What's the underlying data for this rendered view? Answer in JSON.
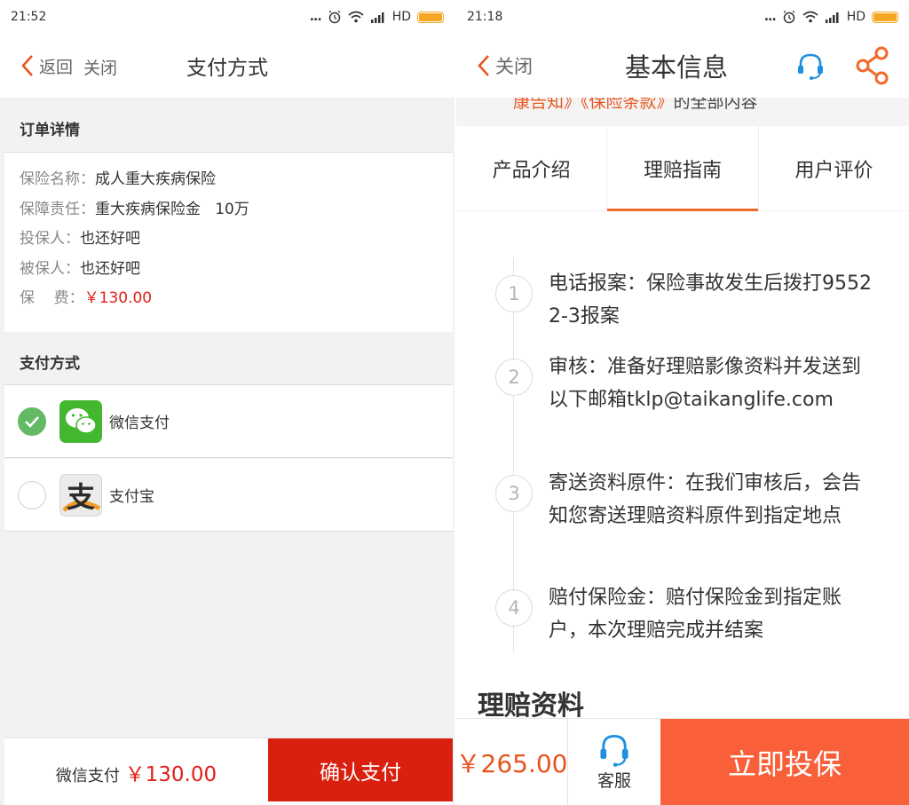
{
  "left": {
    "status": {
      "time": "21:52",
      "dots": "...",
      "network": "HD"
    },
    "nav": {
      "back_label": "返回",
      "close_label": "关闭",
      "title": "支付方式"
    },
    "order": {
      "heading": "订单详情",
      "rows": [
        {
          "key": "保险名称：",
          "value": "成人重大疾病保险"
        },
        {
          "key": "保障责任：",
          "value": "重大疾病保险金   10万"
        },
        {
          "key": "投保人：",
          "value": "也还好吧"
        },
        {
          "key": "被保人：",
          "value": "也还好吧"
        },
        {
          "key": "保    费：",
          "value": "￥130.00"
        }
      ]
    },
    "payment": {
      "heading": "支付方式",
      "options": [
        {
          "label": "微信支付",
          "selected": true
        },
        {
          "label": "支付宝",
          "selected": false
        }
      ],
      "alipay_glyph": "支"
    },
    "footer": {
      "method": "微信支付",
      "amount": "￥130.00",
      "confirm_label": "确认支付"
    },
    "colors": {
      "accent_red": "#d9200f",
      "check_green": "#64b964",
      "wechat_green": "#43b72f"
    }
  },
  "right": {
    "status": {
      "time": "21:18",
      "dots": "...",
      "network": "HD"
    },
    "nav": {
      "close_label": "关闭",
      "title": "基本信息"
    },
    "tos_strip": {
      "part1": "康告知》《保险条款》",
      "part2": "的全部内容"
    },
    "tabs": [
      {
        "label": "产品介绍",
        "active": false
      },
      {
        "label": "理赔指南",
        "active": true
      },
      {
        "label": "用户评价",
        "active": false
      }
    ],
    "steps": [
      {
        "num": "1",
        "text": "电话报案：保险事故发生后拨打95522-3报案"
      },
      {
        "num": "2",
        "text": "审核：准备好理赔影像资料并发送到以下邮箱tklp@taikanglife.com"
      },
      {
        "num": "3",
        "text": "寄送资料原件：在我们审核后，会告知您寄送理赔资料原件到指定地点"
      },
      {
        "num": "4",
        "text": "赔付保险金：赔付保险金到指定账户，本次理赔完成并结案"
      }
    ],
    "claims_title": "理赔资料",
    "footer": {
      "price": "￥265.00",
      "service_label": "客服",
      "buy_label": "立即投保"
    },
    "colors": {
      "accent_orange": "#f06a2c",
      "buy_orange": "#f9603a",
      "tab_underline": "#f06a2c"
    }
  }
}
